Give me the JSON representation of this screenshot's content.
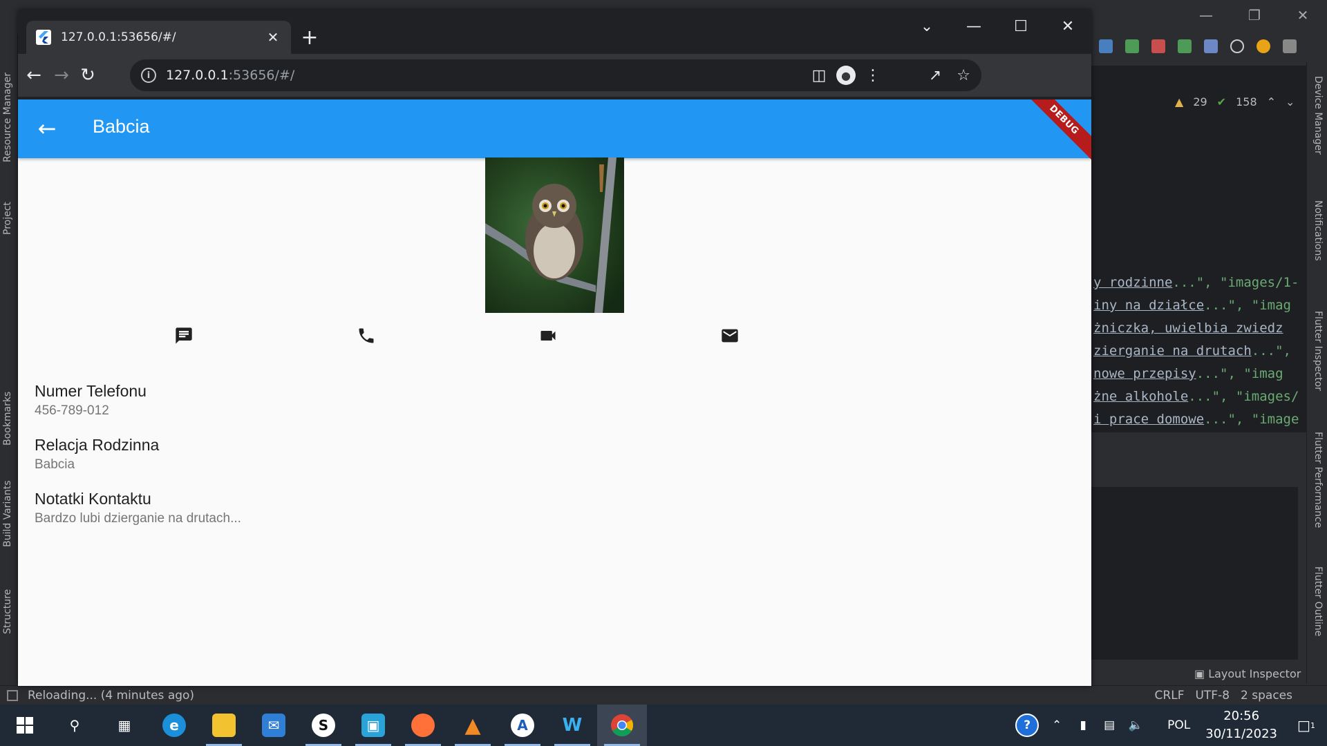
{
  "ide": {
    "left_panels": [
      "Resource Manager",
      "Project",
      "Bookmarks",
      "Build Variants",
      "Structure"
    ],
    "right_panels": [
      "Device Manager",
      "Notifications",
      "Flutter Inspector",
      "Flutter Performance",
      "Flutter Outline"
    ],
    "inspections": {
      "warnings": "29",
      "ok": "158"
    },
    "code_lines": [
      [
        "y rodzinne",
        "...\", \"images/1-"
      ],
      [
        "iny na działce",
        "...\", \"imag"
      ],
      [
        "żniczka, uwielbia zwiedz",
        ""
      ],
      [
        "zierganie na drutach",
        "...\","
      ],
      [
        " nowe przepisy",
        "...\", \"imag"
      ],
      [
        "żne alkohole",
        "...\", \"images/"
      ],
      [
        "i prace domowe",
        "...\", \"image"
      ]
    ],
    "layout_inspector": "Layout Inspector",
    "status": {
      "left": "Reloading... (4 minutes ago)",
      "line_sep": "CRLF",
      "encoding": "UTF-8",
      "indent": "2 spaces"
    }
  },
  "browser": {
    "tab_title": "127.0.0.1:53656/#/",
    "url_host": "127.0.0.1",
    "url_rest": ":53656/#/"
  },
  "app": {
    "title": "Babcia",
    "debug_label": "DEBUG",
    "actions": [
      "message-icon",
      "phone-icon",
      "video-call-icon",
      "email-icon"
    ],
    "fields": [
      {
        "label": "Numer Telefonu",
        "value": "456-789-012"
      },
      {
        "label": "Relacja Rodzinna",
        "value": "Babcia"
      },
      {
        "label": "Notatki Kontaktu",
        "value": "Bardzo lubi dzierganie na drutach..."
      }
    ],
    "accent": "#2196f3"
  },
  "taskbar": {
    "apps": [
      "start",
      "search",
      "task-view",
      "edge",
      "file-explorer",
      "mail",
      "app-s",
      "app-cube",
      "firefox",
      "vlc",
      "app-a",
      "app-w",
      "chrome"
    ],
    "language": "POL",
    "time": "20:56",
    "date": "30/11/2023",
    "notification_count": "1"
  }
}
